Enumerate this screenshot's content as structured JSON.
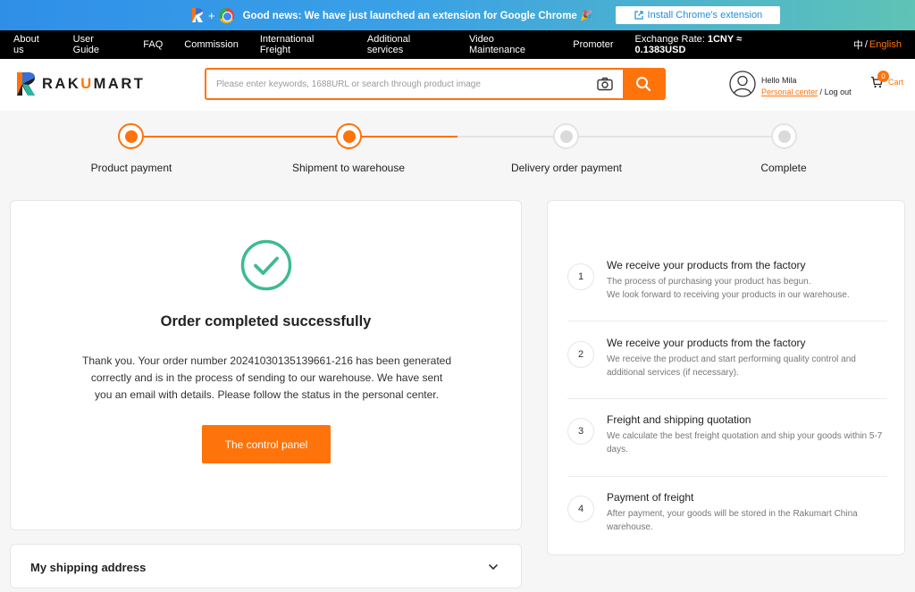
{
  "promo": {
    "text": "Good news: We have just launched an extension for Google Chrome",
    "emoji": "🎉",
    "button_label": "Install Chrome's extension"
  },
  "topnav": {
    "items": [
      "About us",
      "User Guide",
      "FAQ",
      "Commission",
      "International Freight",
      "Additional services",
      "Video Maintenance",
      "Promoter"
    ],
    "exchange_label": "Exchange Rate:",
    "exchange_value": "1CNY ≈ 0.1383USD",
    "lang_zh": "中",
    "lang_sep": "/",
    "lang_en": "English"
  },
  "header": {
    "logo_pre": "RAK",
    "logo_u": "U",
    "logo_post": "MART",
    "search_placeholder": "Please enter keywords, 1688URL or search through product image",
    "greeting": "Hello Mila",
    "personal_center": "Personal center",
    "separator": " / ",
    "logout": "Log out",
    "cart_count": "0",
    "cart_label": "Cart"
  },
  "steps": [
    {
      "label": "Product payment",
      "state": "active"
    },
    {
      "label": "Shipment to warehouse",
      "state": "active"
    },
    {
      "label": "Delivery order payment",
      "state": "inactive"
    },
    {
      "label": "Complete",
      "state": "inactive"
    }
  ],
  "success": {
    "title": "Order completed successfully",
    "message": "Thank you. Your order number 20241030135139661-216 has been generated correctly and is in the process of sending to our warehouse. We have sent you an email with details. Please follow the status in the personal center.",
    "button_label": "The control panel"
  },
  "address": {
    "title": "My shipping address"
  },
  "info_steps": [
    {
      "num": "1",
      "title": "We receive your products from the factory",
      "desc": "The process of purchasing your product has begun.\nWe look forward to receiving your products in our warehouse."
    },
    {
      "num": "2",
      "title": "We receive your products from the factory",
      "desc": "We receive the product and start performing quality control and additional services (if necessary)."
    },
    {
      "num": "3",
      "title": "Freight and shipping quotation",
      "desc": "We calculate the best freight quotation and ship your goods within 5-7 days."
    },
    {
      "num": "4",
      "title": "Payment of freight",
      "desc": "After payment, your goods will be stored in the Rakumart China warehouse."
    }
  ],
  "colors": {
    "accent": "#ff730b",
    "success": "#3ebb8f",
    "nav_bg": "#000000"
  }
}
